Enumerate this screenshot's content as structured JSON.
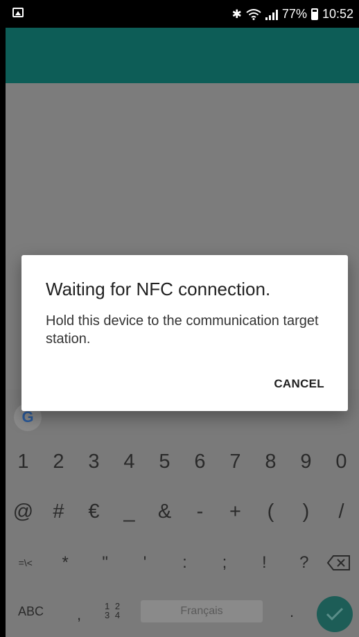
{
  "status_bar": {
    "battery_percent": "77%",
    "time": "10:52",
    "icons": [
      "gallery-icon",
      "bluetooth-icon",
      "wifi-icon",
      "signal-icon",
      "battery-icon"
    ]
  },
  "colors": {
    "app_bar": "#0d5d57",
    "dim_overlay": "#7a7a7a",
    "accent": "#1d5d57"
  },
  "dialog": {
    "title": "Waiting for NFC connection.",
    "message": "Hold this device to the communication target station.",
    "cancel_label": "CANCEL"
  },
  "keyboard": {
    "row1": [
      "1",
      "2",
      "3",
      "4",
      "5",
      "6",
      "7",
      "8",
      "9",
      "0"
    ],
    "row2": [
      "@",
      "#",
      "€",
      "_",
      "&",
      "-",
      "+",
      "(",
      ")",
      "/"
    ],
    "row3": [
      "=\\<",
      "*",
      "\"",
      "'",
      ":",
      ";",
      "!",
      "?"
    ],
    "abc_label": "ABC",
    "comma_label": ",",
    "num_label_top": "1 2",
    "num_label_bottom": "3 4",
    "space_label": "Français",
    "period_label": "."
  }
}
